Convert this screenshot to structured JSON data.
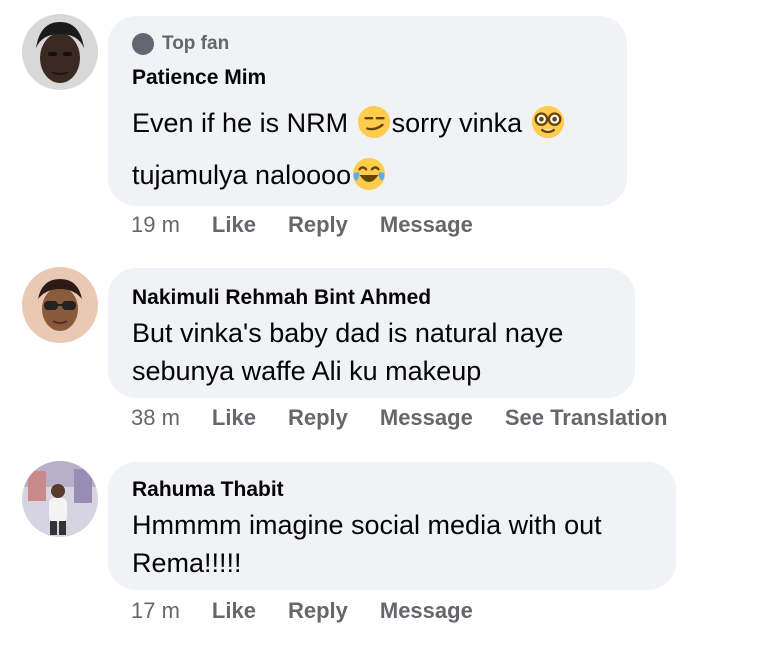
{
  "comments": [
    {
      "badge": "Top fan",
      "author": "Patience Mim",
      "lines": [
        "Even if he is NRM",
        "sorry vinka",
        "tujamulya naloooo"
      ],
      "time": "19 m",
      "actions": [
        "Like",
        "Reply",
        "Message"
      ],
      "emojis": [
        "smirk-emoji",
        "nerd-emoji",
        "laughing-tears-emoji"
      ]
    },
    {
      "author": "Nakimuli Rehmah Bint Ahmed",
      "lines": [
        "But vinka's baby dad is natural naye",
        "sebunya waffe Ali ku makeup"
      ],
      "time": "38 m",
      "actions": [
        "Like",
        "Reply",
        "Message",
        "See Translation"
      ]
    },
    {
      "author": "Rahuma Thabit",
      "lines": [
        "Hmmmm imagine social media with out",
        "Rema!!!!!"
      ],
      "time": "17 m",
      "actions": [
        "Like",
        "Reply",
        "Message"
      ]
    }
  ],
  "colors": {
    "bubble": "#f0f2f5",
    "meta": "#65676b",
    "text": "#050505",
    "badge_dot": "#606770",
    "emoji": "#ffcc4d"
  }
}
